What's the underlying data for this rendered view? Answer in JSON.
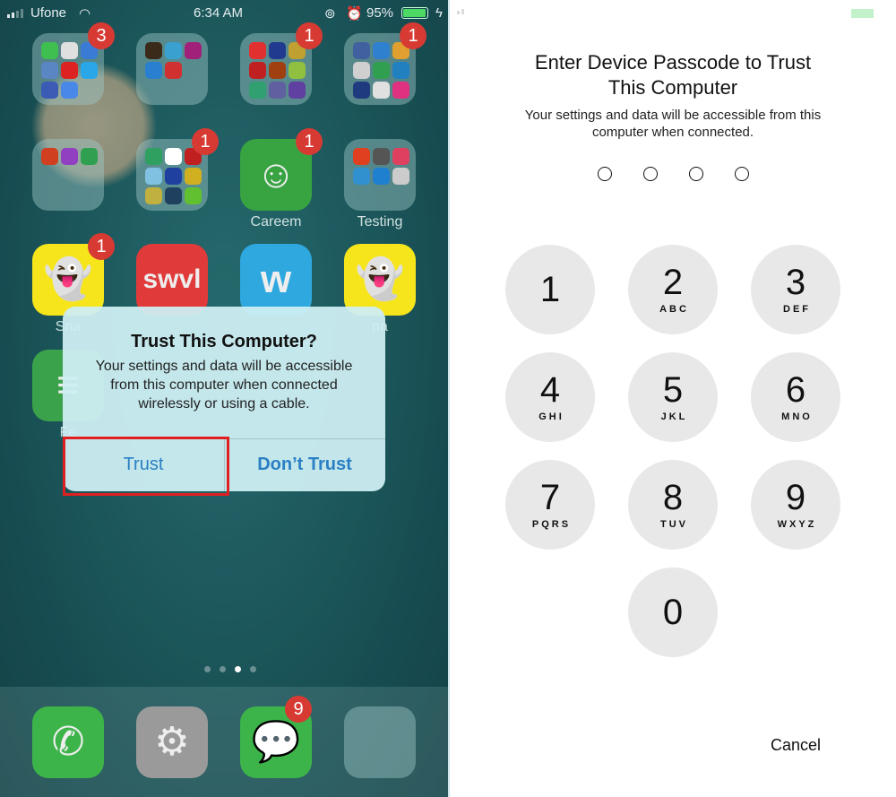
{
  "left": {
    "status": {
      "carrier": "Ufone",
      "time": "6:34 AM",
      "battery": "95%",
      "battery_level": 95
    },
    "grid": [
      {
        "type": "folder",
        "badge": "3",
        "label": "",
        "minis": [
          "#3fbf4f",
          "#e0e0e0",
          "#3a7bd5",
          "#5b86c4",
          "#d22",
          "#2aa7e8",
          "#3b5bb5",
          "#4a88e8"
        ]
      },
      {
        "type": "folder",
        "badge": "",
        "label": "",
        "minis": [
          "#3a2a1a",
          "#3aa0d0",
          "#a0207a",
          "#2a80d0",
          "#d03030"
        ]
      },
      {
        "type": "folder",
        "badge": "1",
        "label": "",
        "minis": [
          "#e03030",
          "#203a90",
          "#c0a030",
          "#c02020",
          "#a04010",
          "#90c040",
          "#30a070",
          "#6060a0",
          "#6040a0"
        ]
      },
      {
        "type": "folder",
        "badge": "1",
        "label": "",
        "minis": [
          "#4060a0",
          "#3080d0",
          "#e0a030",
          "#d0d0d0",
          "#30a050",
          "#2080c0",
          "#203a80",
          "#e0e0e0",
          "#e03080"
        ]
      },
      {
        "type": "folder",
        "badge": "",
        "label": "",
        "minis": [
          "#d04020",
          "#9040c0",
          "#30a050"
        ]
      },
      {
        "type": "folder",
        "badge": "1",
        "label": "",
        "minis": [
          "#30a060",
          "#ffffff",
          "#c02020",
          "#80c0e0",
          "#2040a0",
          "#d0b020",
          "#c0b040",
          "#204060",
          "#60c030"
        ]
      },
      {
        "type": "app",
        "badge": "1",
        "label": "Careem",
        "color": "#37a441",
        "glyph": "☺"
      },
      {
        "type": "folder",
        "badge": "",
        "label": "Testing",
        "minis": [
          "#e04020",
          "#555",
          "#e04060",
          "#3090d0",
          "#2080d0",
          "#ccc"
        ]
      },
      {
        "type": "app",
        "badge": "1",
        "label": "Sna",
        "color": "#f7e51c",
        "glyph": "👻"
      },
      {
        "type": "app",
        "badge": "",
        "label": "",
        "color": "#e03a3a",
        "glyph": "swvl"
      },
      {
        "type": "app",
        "badge": "",
        "label": "",
        "color": "#2fa8e0",
        "glyph": "w"
      },
      {
        "type": "app",
        "badge": "",
        "label": "na",
        "color": "#f7e51c",
        "glyph": "👻"
      },
      {
        "type": "app",
        "badge": "",
        "label": "Fe",
        "color": "#3aa24a",
        "glyph": "≡"
      }
    ],
    "dock": [
      {
        "name": "phone",
        "color": "#3db44a",
        "glyph": "✆",
        "badge": ""
      },
      {
        "name": "settings",
        "color": "#9a9a9a",
        "glyph": "⚙",
        "badge": ""
      },
      {
        "name": "messages",
        "color": "#3db44a",
        "glyph": "💬",
        "badge": "9"
      },
      {
        "name": "folder",
        "color": "rgba(160,200,200,.45)",
        "glyph": "",
        "badge": ""
      }
    ],
    "page_dots": {
      "count": 4,
      "active": 2
    },
    "dialog": {
      "title": "Trust This Computer?",
      "message": "Your settings and data will be accessible from this computer when connected wirelessly or using a cable.",
      "trust": "Trust",
      "dont_trust": "Don’t Trust",
      "highlight_color": "#e02020"
    }
  },
  "right": {
    "title_line1": "Enter Device Passcode to Trust",
    "title_line2": "This Computer",
    "subtitle_line1": "Your settings and data will be accessible from this",
    "subtitle_line2": "computer when connected.",
    "passcode_length": 4,
    "keys": [
      {
        "n": "1",
        "l": ""
      },
      {
        "n": "2",
        "l": "ABC"
      },
      {
        "n": "3",
        "l": "DEF"
      },
      {
        "n": "4",
        "l": "GHI"
      },
      {
        "n": "5",
        "l": "JKL"
      },
      {
        "n": "6",
        "l": "MNO"
      },
      {
        "n": "7",
        "l": "PQRS"
      },
      {
        "n": "8",
        "l": "TUV"
      },
      {
        "n": "9",
        "l": "WXYZ"
      },
      {
        "n": "0",
        "l": ""
      }
    ],
    "cancel": "Cancel"
  }
}
